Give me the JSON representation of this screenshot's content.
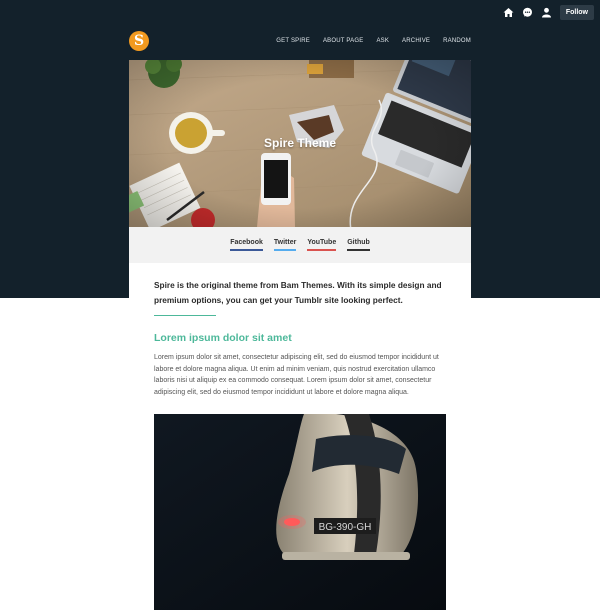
{
  "tumblr_controls": {
    "follow_label": "Follow"
  },
  "header": {
    "logo_letter": "S",
    "nav": [
      "GET SPIRE",
      "ABOUT PAGE",
      "ASK",
      "ARCHIVE",
      "RANDOM"
    ]
  },
  "hero": {
    "title": "Spire Theme"
  },
  "social": {
    "facebook": "Facebook",
    "twitter": "Twitter",
    "youtube": "YouTube",
    "github": "Github"
  },
  "intro": "Spire is the original theme from Bam Themes. With its simple design and premium options, you can get your Tumblr site looking perfect.",
  "post": {
    "title": "Lorem ipsum dolor sit amet",
    "body": "Lorem ipsum dolor sit amet, consectetur adipiscing elit, sed do eiusmod tempor incididunt ut labore et dolore magna aliqua. Ut enim ad minim veniam, quis nostrud exercitation ullamco laboris nisi ut aliquip ex ea commodo consequat. Lorem ipsum dolor sit amet, consectetur adipiscing elit, sed do eiusmod tempor incididunt ut labore et dolore magna aliqua.",
    "plate": "BG-390-GH"
  },
  "colors": {
    "header_bg": "#13212b",
    "logo": "#f29a1f",
    "accent": "#4db89a"
  }
}
